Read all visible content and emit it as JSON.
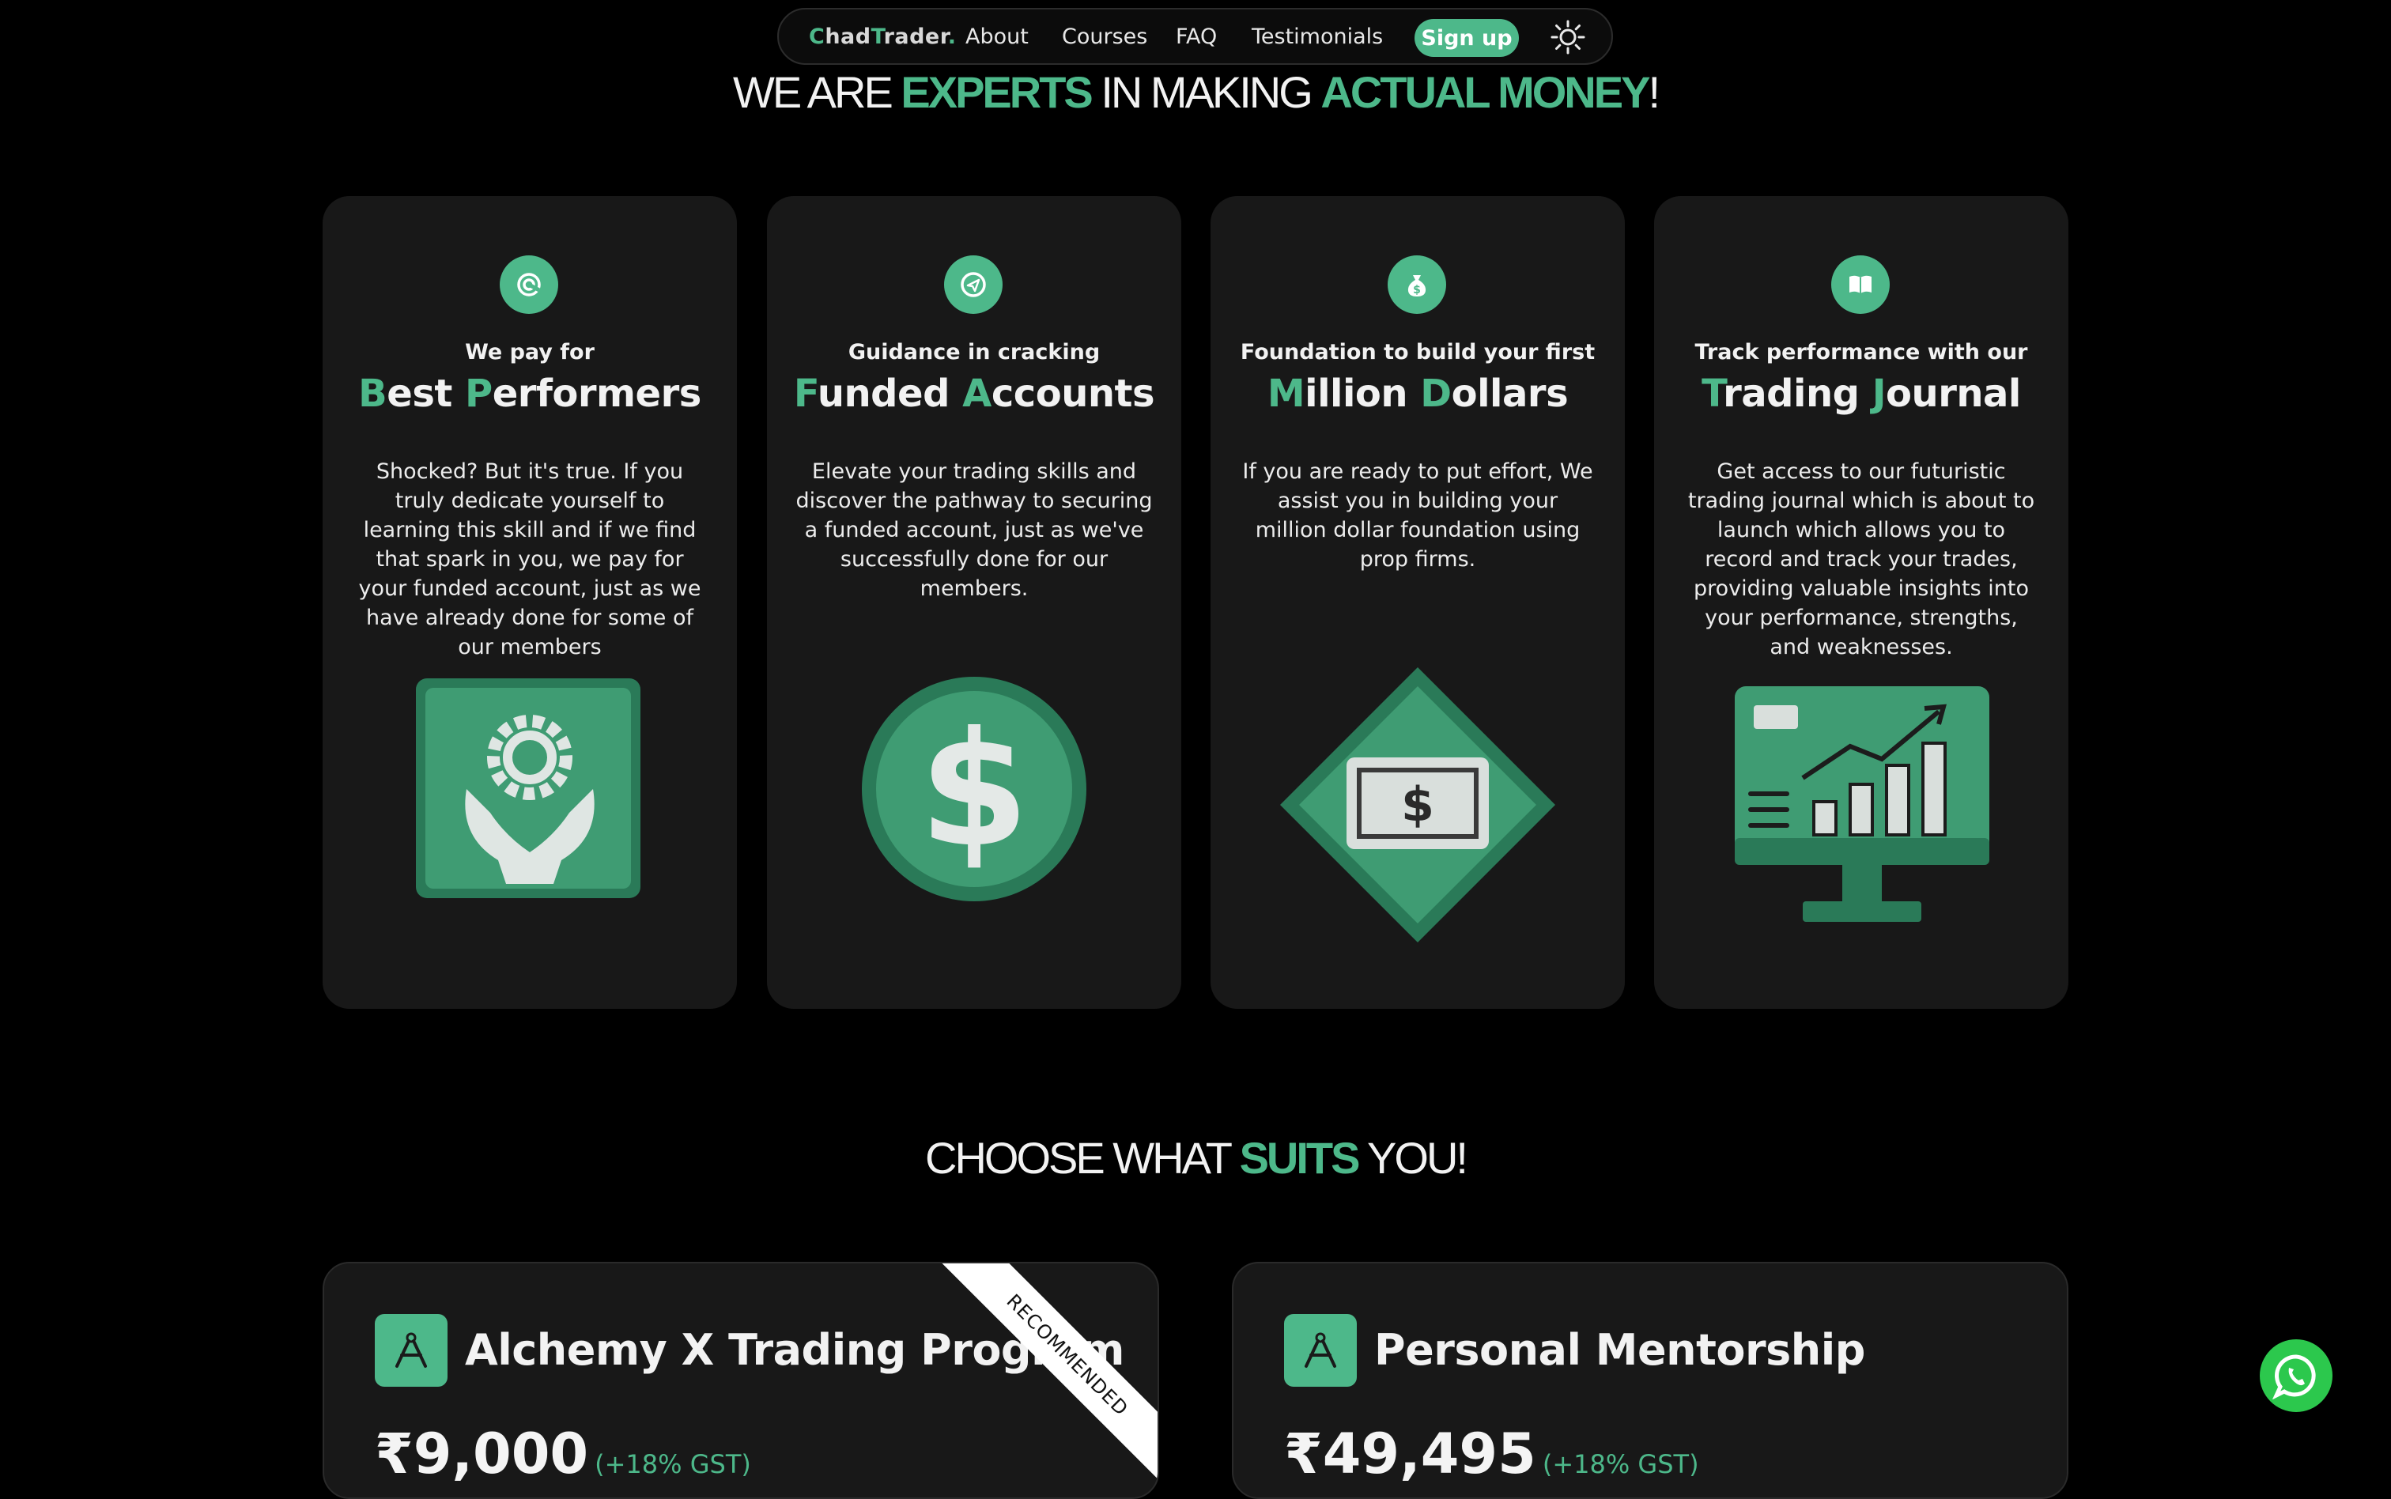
{
  "nav": {
    "logo_c": "C",
    "logo_had": "had",
    "logo_t": "T",
    "logo_rader": "rader",
    "logo_dot": ".",
    "links": [
      "About",
      "Courses",
      "FAQ",
      "Testimonials"
    ],
    "signup": "Sign up",
    "theme_icon": "sun-icon"
  },
  "hero": {
    "p1": "WE ARE ",
    "p2": "EXPERTS",
    "p3": " IN MAKING ",
    "p4": "ACTUAL MONEY",
    "p5": "!"
  },
  "features": [
    {
      "icon": "target-icon",
      "eyebrow": "We pay for",
      "t1c": "B",
      "t1": "est ",
      "t2c": "P",
      "t2": "erformers",
      "desc": "Shocked? But it's true. If you truly dedicate yourself to learning this skill and if we find that spark in you, we pay for your funded account, just as we have already done for some of our members",
      "illustration": "hands-gear-icon"
    },
    {
      "icon": "send-icon",
      "eyebrow": "Guidance in cracking",
      "t1c": "F",
      "t1": "unded ",
      "t2c": "A",
      "t2": "ccounts",
      "desc": "Elevate your trading skills and discover the pathway to securing a funded account, just as we've successfully done for our members.",
      "illustration": "dollar-coin-icon"
    },
    {
      "icon": "money-bag-icon",
      "eyebrow": "Foundation to build your first",
      "t1c": "M",
      "t1": "illion ",
      "t2c": "D",
      "t2": "ollars",
      "desc": "If you are ready to put effort, We assist you in building your million dollar foundation using prop firms.",
      "illustration": "cash-diamond-icon"
    },
    {
      "icon": "book-icon",
      "eyebrow": "Track performance with our",
      "t1c": "T",
      "t1": "rading ",
      "t2c": "J",
      "t2": "ournal",
      "desc": "Get access to our futuristic trading journal which is about to launch which allows you to record and track your trades, providing valuable insights into your performance, strengths, and weaknesses.",
      "illustration": "chart-monitor-icon"
    }
  ],
  "pricing_heading": {
    "p1": "CHOOSE WHAT ",
    "p2": "SUITS",
    "p3": " YOU!"
  },
  "plans": [
    {
      "name": "Alchemy X Trading Program",
      "price": "₹9,000",
      "gst": "(+18% GST)",
      "ribbon": "RECOMMENDED",
      "icon": "compass-icon"
    },
    {
      "name": "Personal Mentorship",
      "price": "₹49,495",
      "gst": "(+18% GST)",
      "icon": "compass-icon"
    }
  ],
  "whatsapp_icon": "whatsapp-icon",
  "colors": {
    "accent": "#4db88a",
    "card": "#181818",
    "background": "#000000"
  }
}
